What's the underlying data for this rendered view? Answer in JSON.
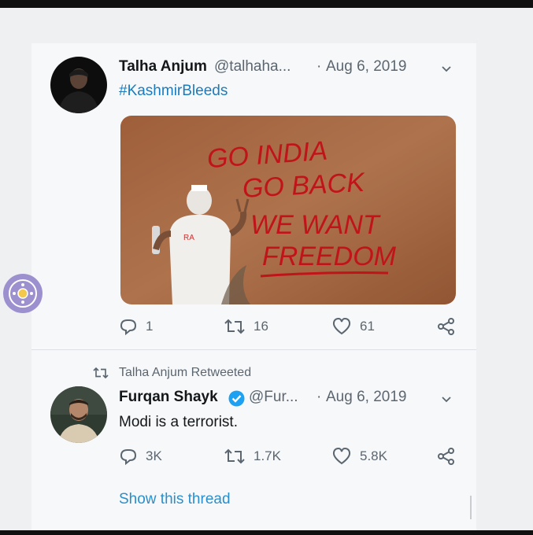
{
  "tweet1": {
    "name": "Talha Anjum",
    "handle": "@talhaha...",
    "separator": "·",
    "date": "Aug 6, 2019",
    "hashtag": "#KashmirBleeds",
    "image_text": [
      "GO INDIA",
      "GO BACK",
      "WE WANT",
      "FREEDOM"
    ],
    "replies": "1",
    "retweets": "16",
    "likes": "61"
  },
  "retweet_label": "Talha Anjum Retweeted",
  "tweet2": {
    "name": "Furqan Shayk",
    "handle": "@Fur...",
    "separator": "·",
    "date": "Aug 6, 2019",
    "text": "Modi is a terrorist.",
    "replies": "3K",
    "retweets": "1.7K",
    "likes": "5.8K"
  },
  "show_thread": "Show this thread",
  "colors": {
    "link": "#1b7bbd",
    "verified": "#1da1f2",
    "muted": "#5b6670",
    "graffiti": "#c0141a"
  },
  "icons": [
    "chevron-down-icon",
    "reply-icon",
    "retweet-icon",
    "like-icon",
    "share-icon",
    "verified-icon",
    "retweeted-icon",
    "assistive-touch-icon"
  ]
}
